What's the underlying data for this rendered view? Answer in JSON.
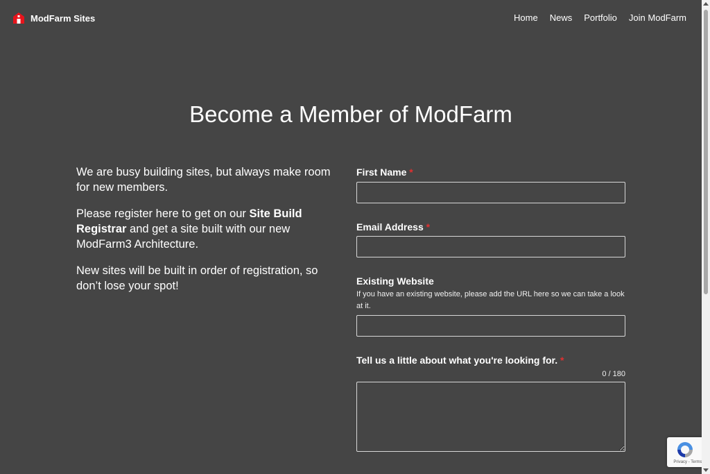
{
  "header": {
    "site_name": "ModFarm Sites",
    "logo_icon": "barn-icon",
    "nav": [
      "Home",
      "News",
      "Portfolio",
      "Join ModFarm"
    ]
  },
  "main": {
    "title": "Become a Member of ModFarm",
    "intro": {
      "p1": "We are busy building sites, but always make room for new members.",
      "p2_before": "Please register here to get on our ",
      "p2_bold": "Site Build Registrar",
      "p2_after": " and get a site built with our new ModFarm3 Architecture.",
      "p3": "New sites will be built in order of registration, so don’t lose your spot!"
    }
  },
  "form": {
    "first_name": {
      "label": "First Name",
      "required": "*",
      "value": ""
    },
    "email": {
      "label": "Email Address",
      "required": "*",
      "value": ""
    },
    "website": {
      "label": "Existing Website",
      "help": "If you have an existing website, please add the URL here so we can take a look at it.",
      "value": ""
    },
    "looking_for": {
      "label": "Tell us a little about what you're looking for.",
      "required": "*",
      "counter": "0 / 180",
      "value": ""
    }
  },
  "recaptcha": {
    "links": "Privacy - Terms",
    "icon": "recaptcha-icon"
  },
  "colors": {
    "background": "#454545",
    "text": "#ffffff",
    "required": "#e03030",
    "logo": "#e8141c"
  }
}
